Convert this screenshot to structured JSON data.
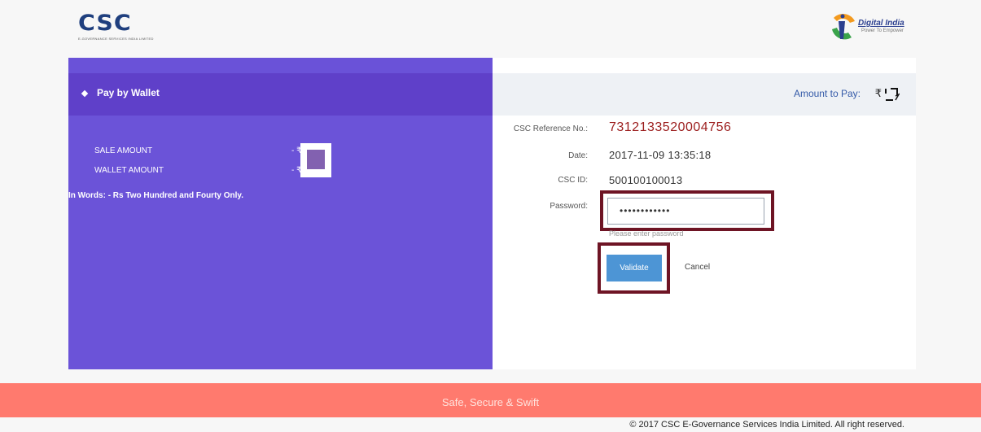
{
  "header": {
    "csc_logo_text": "CSC",
    "csc_logo_tagline": "E-GOVERNANCE SERVICES INDIA LIMITED",
    "digital_india_title": "Digital India",
    "digital_india_subtitle": "Power To Empower"
  },
  "wallet": {
    "title": "Pay by Wallet",
    "sale_amount_label": "SALE AMOUNT",
    "wallet_amount_label": "WALLET AMOUNT",
    "sale_amount_prefix": "- ₹",
    "wallet_amount_prefix": "- ₹",
    "in_words": "In Words: - Rs Two Hundred and Fourty Only."
  },
  "payment": {
    "amount_label": "Amount to Pay:",
    "currency_symbol": "₹",
    "ref_label": "CSC Reference No.:",
    "ref_value": "7312133520004756",
    "date_label": "Date:",
    "date_value": "2017-11-09 13:35:18",
    "csc_id_label": "CSC ID:",
    "csc_id_value": "500100100013",
    "password_label": "Password:",
    "password_value": "••••••••••••",
    "password_hint": "Please enter password",
    "validate_label": "Validate",
    "cancel_label": "Cancel"
  },
  "footer": {
    "tagline": "Safe, Secure & Swift",
    "copyright": "© 2017 CSC E-Governance Services India Limited. All right reserved."
  },
  "colors": {
    "wallet_panel": "#6b53d8",
    "wallet_header": "#5f40c9",
    "reference_text": "#9b1c1c",
    "validate_button": "#4d95d5",
    "footer_bar": "#ff7a6e",
    "highlight_outline": "#6e1424"
  }
}
